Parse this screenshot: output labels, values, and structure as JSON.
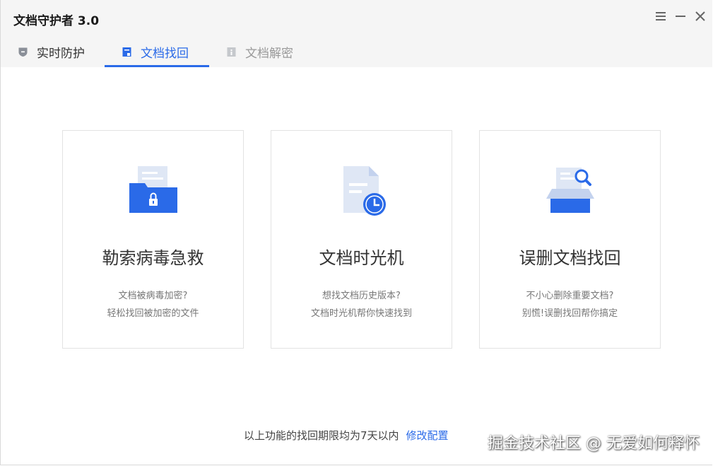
{
  "app": {
    "title": "文档守护者 3.0"
  },
  "window_controls": {
    "menu_icon": "menu-icon",
    "minimize_icon": "minimize-icon",
    "close_icon": "close-icon"
  },
  "tabs": [
    {
      "label": "实时防护",
      "icon": "shield-icon",
      "active": false
    },
    {
      "label": "文档找回",
      "icon": "document-icon",
      "active": true
    },
    {
      "label": "文档解密",
      "icon": "unlock-document-icon",
      "active": false
    }
  ],
  "cards": [
    {
      "title": "勒索病毒急救",
      "desc1": "文档被病毒加密?",
      "desc2": "轻松找回被加密的文件",
      "icon": "locked-folder-icon"
    },
    {
      "title": "文档时光机",
      "desc1": "想找文档历史版本?",
      "desc2": "文档时光机帮你快速找到",
      "icon": "document-clock-icon"
    },
    {
      "title": "误删文档找回",
      "desc1": "不小心删除重要文档?",
      "desc2": "别慌!误删找回帮你搞定",
      "icon": "search-box-icon"
    }
  ],
  "footer": {
    "note": "以上功能的找回期限均为7天以内",
    "link": "修改配置"
  },
  "watermark": "掘金技术社区 @ 无爱如何释怀",
  "colors": {
    "accent": "#2a6ae8",
    "header_bg": "#f5f5f5"
  }
}
